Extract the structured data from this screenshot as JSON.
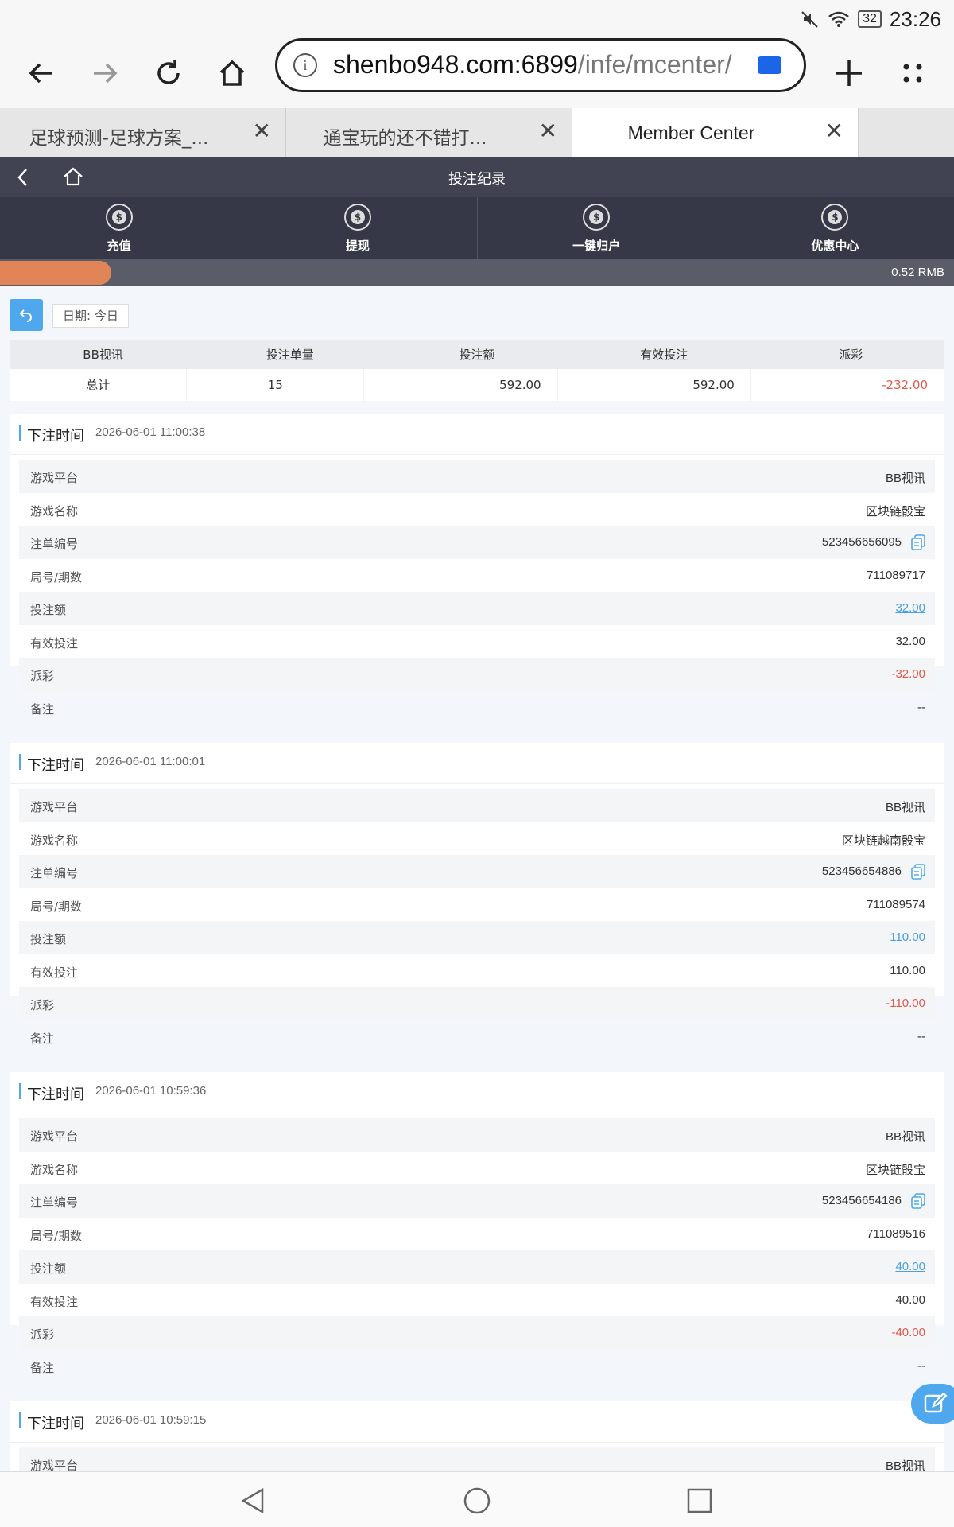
{
  "status_bar": {
    "battery": "32",
    "time": "23:26"
  },
  "browser": {
    "url_host": "shenbo948.com:6899",
    "url_path": "/infe/mcenter/",
    "tabs": [
      {
        "label": "足球预测-足球方案_..."
      },
      {
        "label": "通宝玩的还不错打..."
      },
      {
        "label": "Member Center"
      }
    ]
  },
  "site": {
    "title": "投注纪录",
    "nav": [
      {
        "label": "充值"
      },
      {
        "label": "提现"
      },
      {
        "label": "一键归户"
      },
      {
        "label": "优惠中心"
      }
    ],
    "balance": "0.52 RMB"
  },
  "filter": {
    "date_chip": "日期: 今日"
  },
  "summary": {
    "headers": [
      "BB视讯",
      "投注单量",
      "投注额",
      "有效投注",
      "派彩"
    ],
    "row": [
      "总计",
      "15",
      "592.00",
      "592.00",
      "-232.00"
    ]
  },
  "record_labels": {
    "time": "下注时间",
    "platform": "游戏平台",
    "game": "游戏名称",
    "order": "注单编号",
    "round": "局号/期数",
    "bet": "投注额",
    "valid": "有效投注",
    "payout": "派彩",
    "note": "备注"
  },
  "records": [
    {
      "time": "2026-06-01 11:00:38",
      "platform": "BB视讯",
      "game": "区块链骰宝",
      "order": "523456656095",
      "round": "711089717",
      "bet": "32.00",
      "valid": "32.00",
      "payout": "-32.00",
      "note": "--"
    },
    {
      "time": "2026-06-01 11:00:01",
      "platform": "BB视讯",
      "game": "区块链越南骰宝",
      "order": "523456654886",
      "round": "711089574",
      "bet": "110.00",
      "valid": "110.00",
      "payout": "-110.00",
      "note": "--"
    },
    {
      "time": "2026-06-01 10:59:36",
      "platform": "BB视讯",
      "game": "区块链骰宝",
      "order": "523456654186",
      "round": "711089516",
      "bet": "40.00",
      "valid": "40.00",
      "payout": "-40.00",
      "note": "--"
    },
    {
      "time": "2026-06-01 10:59:15",
      "platform": "BB视讯"
    }
  ],
  "colors": {
    "accent": "#4fa8ee",
    "negative": "#e0584a",
    "header_bg": "#414353"
  }
}
